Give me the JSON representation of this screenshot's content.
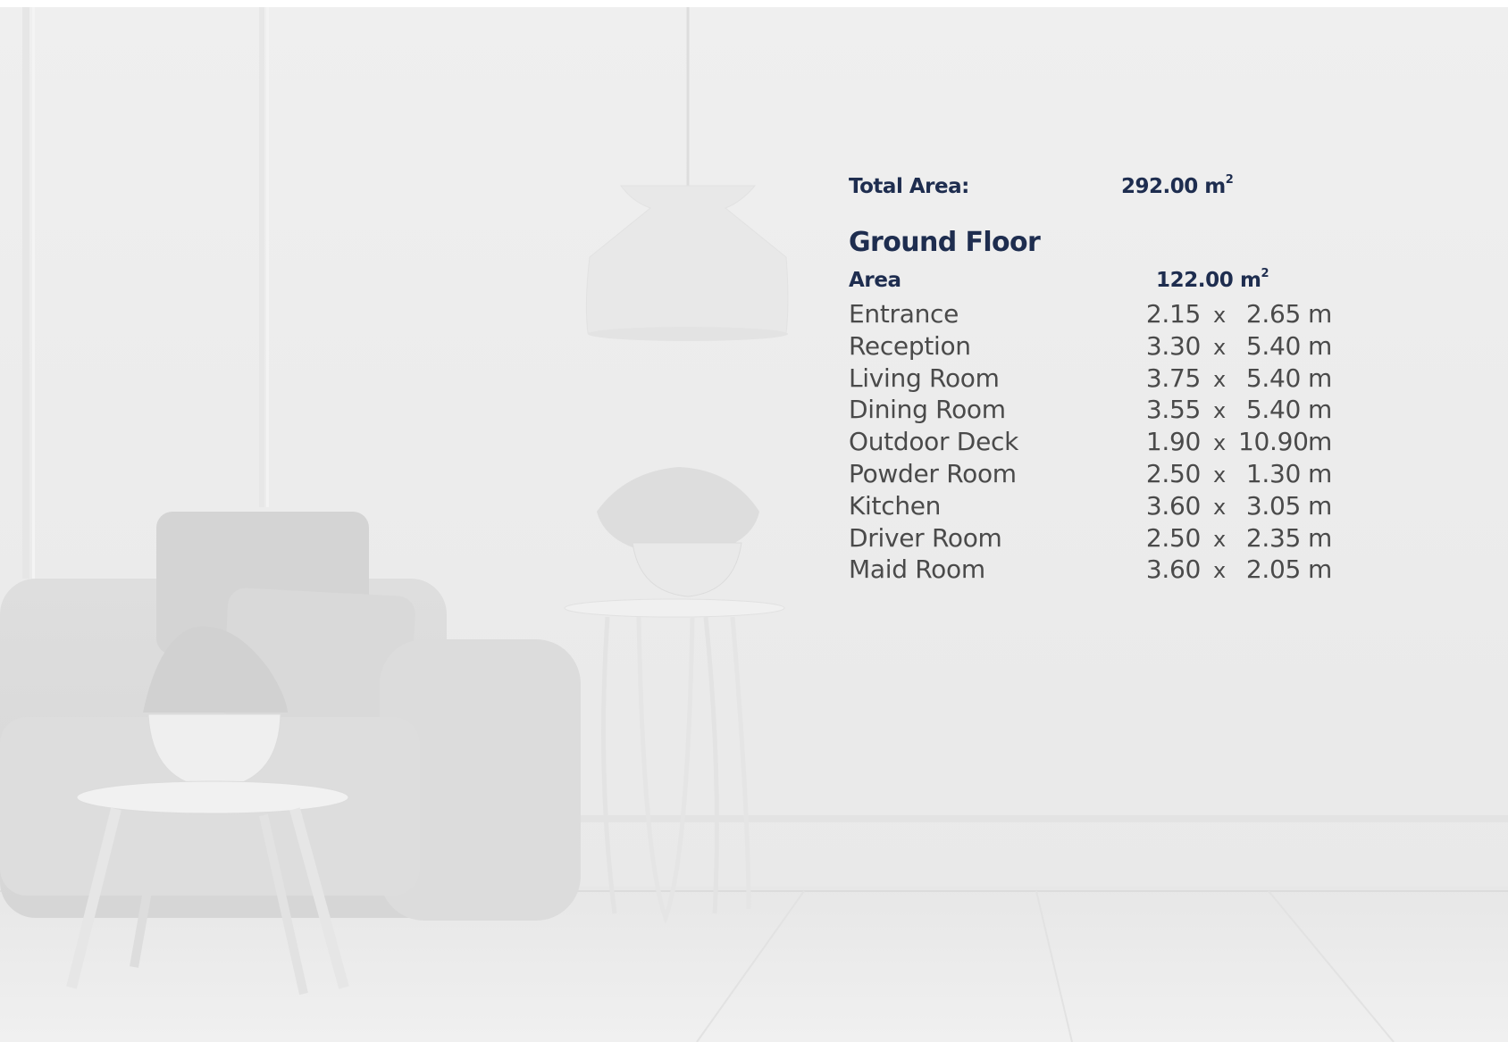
{
  "summary": {
    "total_label": "Total Area:",
    "total_value": "292.00 m",
    "total_unit_sup": "2"
  },
  "ground_floor": {
    "title": "Ground Floor",
    "area_label": "Area",
    "area_value": "122.00 m",
    "area_unit_sup": "2",
    "rooms": [
      {
        "name": "Entrance",
        "width": "2.15",
        "x": "x",
        "length": "2.65",
        "unit": "m"
      },
      {
        "name": "Reception",
        "width": "3.30",
        "x": "x",
        "length": "5.40",
        "unit": "m"
      },
      {
        "name": "Living Room",
        "width": "3.75",
        "x": "x",
        "length": "5.40",
        "unit": "m"
      },
      {
        "name": "Dining Room",
        "width": "3.55",
        "x": "x",
        "length": "5.40",
        "unit": "m"
      },
      {
        "name": "Outdoor Deck",
        "width": "1.90",
        "x": "x",
        "length": "10.90",
        "unit": "m"
      },
      {
        "name": "Powder Room",
        "width": "2.50",
        "x": "x",
        "length": "1.30",
        "unit": "m"
      },
      {
        "name": "Kitchen",
        "width": "3.60",
        "x": "x",
        "length": "3.05",
        "unit": "m"
      },
      {
        "name": "Driver Room",
        "width": "2.50",
        "x": "x",
        "length": "2.35",
        "unit": "m"
      },
      {
        "name": "Maid Room",
        "width": "3.60",
        "x": "x",
        "length": "2.05",
        "unit": "m"
      }
    ]
  },
  "colors": {
    "heading": "#1e2d4f",
    "body_text": "#4a4a4a",
    "background": "#ececec"
  }
}
